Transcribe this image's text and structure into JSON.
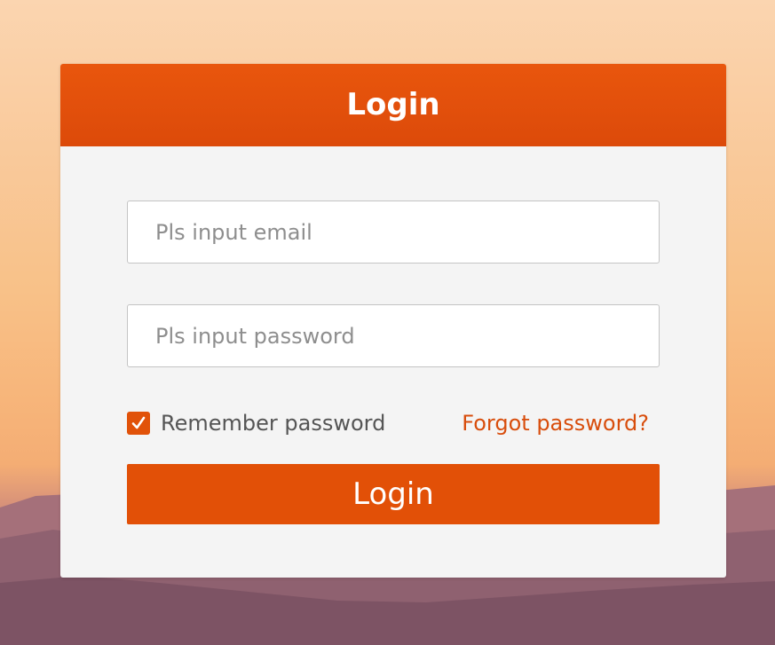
{
  "colors": {
    "accent": "#e25007",
    "header": "#e9560d",
    "link": "#d84d0c",
    "card_background": "#f4f4f4"
  },
  "login_form": {
    "title": "Login",
    "email_placeholder": "Pls input email",
    "email_value": "",
    "password_placeholder": "Pls input password",
    "password_value": "",
    "remember_label": "Remember password",
    "remember_checked": true,
    "forgot_link": "Forgot password?",
    "submit_label": "Login"
  },
  "icons": {
    "checkbox": "checkmark-icon"
  }
}
